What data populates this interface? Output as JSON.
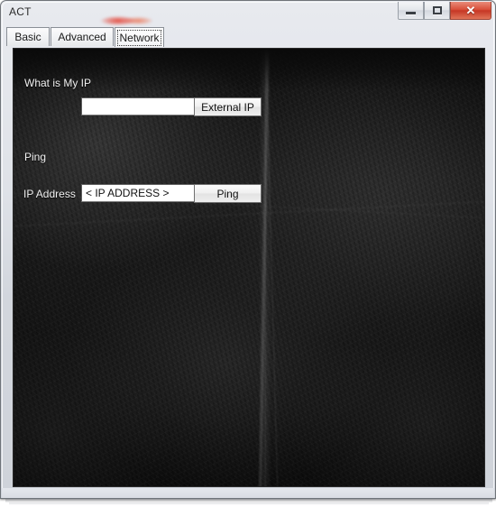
{
  "window": {
    "title": "ACT",
    "controls": {
      "minimize_label": "─",
      "maximize_label": "□",
      "close_label": "✕"
    }
  },
  "tabs": [
    {
      "label": "Basic",
      "selected": false
    },
    {
      "label": "Advanced",
      "selected": false
    },
    {
      "label": "Network",
      "selected": true
    }
  ],
  "network_tab": {
    "what_is_my_ip": {
      "section_label": "What is My IP",
      "input_value": "",
      "input_placeholder": "",
      "button_label": "External IP"
    },
    "ping": {
      "section_label": "Ping",
      "field_label": "IP Address",
      "input_value": "< IP ADDRESS >",
      "input_placeholder": "< IP ADDRESS >",
      "button_label": "Ping"
    }
  },
  "colors": {
    "frame": "#dfe2e8",
    "content_background": "#171717",
    "close_button": "#c63725",
    "text_on_dark": "#f2f2f2",
    "title_text": "#2b2b2b"
  }
}
